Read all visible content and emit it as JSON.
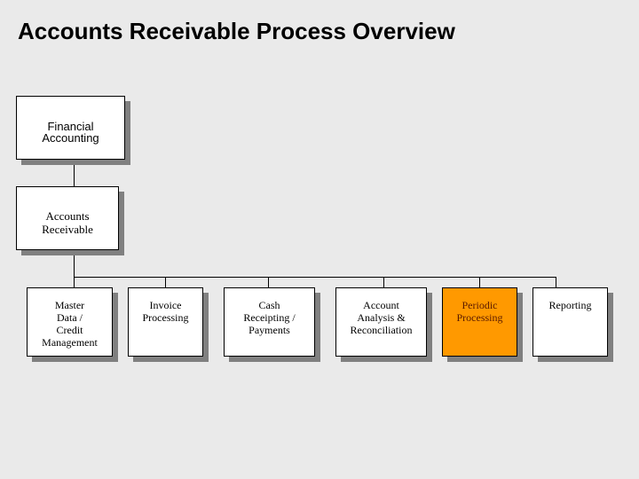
{
  "title": "Accounts Receivable Process Overview",
  "colors": {
    "background": "#eaeaea",
    "box_fill": "#ffffff",
    "box_highlight": "#ff9900",
    "shadow": "#808080",
    "connector": "#000000"
  },
  "hierarchy": {
    "root": {
      "label": "Financial\nAccounting"
    },
    "level2": {
      "label": "Accounts\nReceivable"
    },
    "processes": [
      {
        "label": "Master\nData /\nCredit\nManagement",
        "highlighted": false
      },
      {
        "label": "Invoice\nProcessing",
        "highlighted": false
      },
      {
        "label": "Cash\nReceipting /\nPayments",
        "highlighted": false
      },
      {
        "label": "Account\nAnalysis &\nReconciliation",
        "highlighted": false
      },
      {
        "label": "Periodic\nProcessing",
        "highlighted": true
      },
      {
        "label": "Reporting",
        "highlighted": false
      }
    ]
  }
}
